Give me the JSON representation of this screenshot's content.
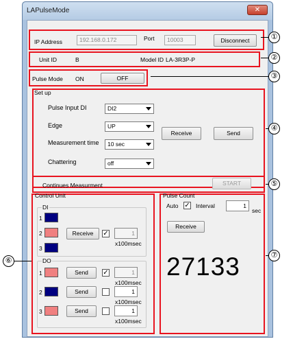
{
  "window": {
    "title": "LAPulseMode",
    "close_glyph": "✕"
  },
  "connection": {
    "ip_label": "IP Address",
    "ip_value": "192.168.0.172",
    "port_label": "Port",
    "port_value": "10003",
    "disconnect_label": "Disconnect"
  },
  "unit": {
    "unit_id_label": "Unit ID",
    "unit_id_value": "B",
    "model_id_label": "Model ID",
    "model_id_value": "LA-3R3P-P"
  },
  "pulse_mode": {
    "label": "Pulse Mode",
    "state": "ON",
    "toggle_label": "OFF"
  },
  "setup": {
    "group_label": "Set up",
    "pulse_input_label": "Pulse Input DI",
    "pulse_input_value": "DI2",
    "edge_label": "Edge",
    "edge_value": "UP",
    "meas_time_label": "Measurement time",
    "meas_time_value": "10  sec",
    "chattering_label": "Chattering",
    "chattering_value": "off",
    "receive_label": "Receive",
    "send_label": "Send"
  },
  "continuous": {
    "label": "Continues Measurment",
    "start_label": "START"
  },
  "control_unit": {
    "group_label": "Control Unit",
    "di_label": "DI",
    "di_rows": [
      {
        "num": "1",
        "color": "#000080"
      },
      {
        "num": "2",
        "color": "#f08080"
      },
      {
        "num": "3",
        "color": "#000080"
      }
    ],
    "di_receive_label": "Receive",
    "di_value": "1",
    "di_unit": "x100msec",
    "do_label": "DO",
    "do_rows": [
      {
        "num": "1",
        "color": "#f08080",
        "send": "Send",
        "checked": true,
        "value": "1",
        "unit": "x100msec"
      },
      {
        "num": "2",
        "color": "#000080",
        "send": "Send",
        "checked": false,
        "value": "1",
        "unit": "x100msec"
      },
      {
        "num": "3",
        "color": "#f08080",
        "send": "Send",
        "checked": false,
        "value": "1",
        "unit": "x100msec"
      }
    ]
  },
  "pulse_count": {
    "group_label": "Pulse Count",
    "auto_label": "Auto",
    "interval_label": "Interval",
    "interval_value": "1",
    "interval_unit": "sec",
    "receive_label": "Receive",
    "count": "27133"
  },
  "callouts": [
    "①",
    "②",
    "③",
    "④",
    "⑤",
    "⑥",
    "⑦"
  ],
  "colors": {
    "highlight": "#e8131f",
    "navy": "#000080",
    "salmon": "#f08080"
  }
}
